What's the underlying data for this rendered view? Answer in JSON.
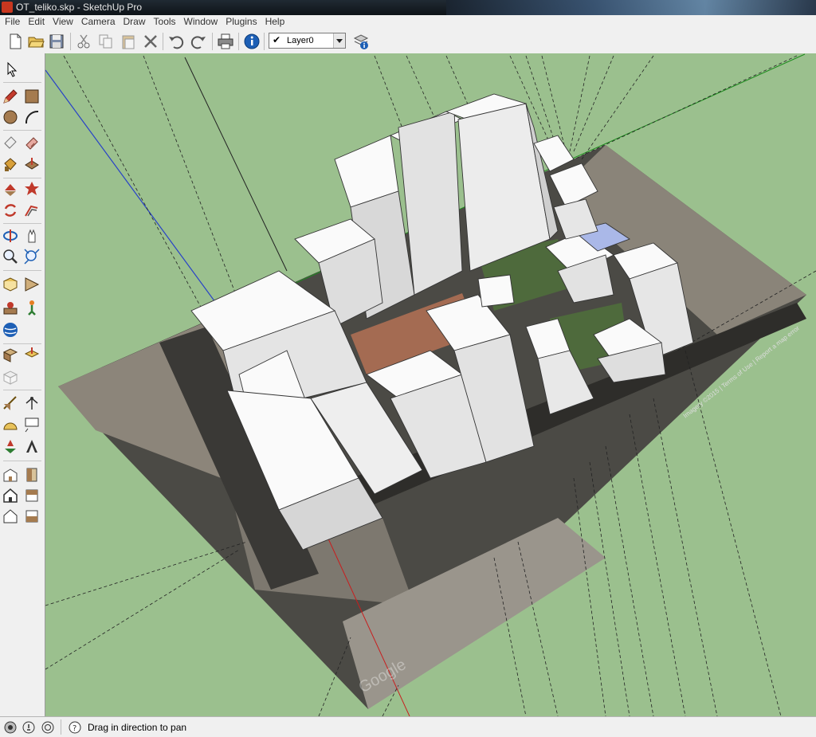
{
  "window": {
    "title": "OT_teliko.skp - SketchUp Pro"
  },
  "menu": {
    "items": [
      "File",
      "Edit",
      "View",
      "Camera",
      "Draw",
      "Tools",
      "Window",
      "Plugins",
      "Help"
    ]
  },
  "toolbar": {
    "icons": [
      "new-icon",
      "open-icon",
      "save-icon",
      "cut-icon",
      "copy-icon",
      "paste-icon",
      "erase-icon",
      "undo-icon",
      "redo-icon",
      "print-icon",
      "model-info-icon"
    ],
    "layer": {
      "check": "✔",
      "name": "Layer0"
    }
  },
  "left_toolbar": {
    "icons": [
      "select-icon",
      "pencil-icon",
      "rectangle-icon",
      "circle-icon",
      "arc-icon",
      "eraser-icon",
      "paint-bucket-icon",
      "tape-measure-icon",
      "push-pull-icon",
      "move-icon",
      "rotate-icon",
      "follow-me-icon",
      "orbit-icon",
      "pan-icon",
      "zoom-icon",
      "zoom-extents-icon",
      "position-camera-icon",
      "walk-icon",
      "look-around-icon",
      "section-plane-icon",
      "components-icon",
      "outliner-icon",
      "text-icon",
      "dimension-icon",
      "3d-text-icon",
      "axes-icon",
      "protractor-icon",
      "iso-view-icon",
      "top-view-icon",
      "front-view-icon",
      "right-view-icon",
      "back-view-icon",
      "left-view-icon"
    ]
  },
  "colors": {
    "sky_ground": "#9bc08e",
    "axis_red": "#c81e1e",
    "axis_green": "#1e8c1e",
    "axis_blue": "#2740c8",
    "building": "#f2f2f2"
  },
  "status": {
    "message": "Drag in direction to pan"
  },
  "imagery": {
    "credit_text": "Imagery ©2015 | Terms of Use | Report a map error",
    "watermark": "Google"
  }
}
